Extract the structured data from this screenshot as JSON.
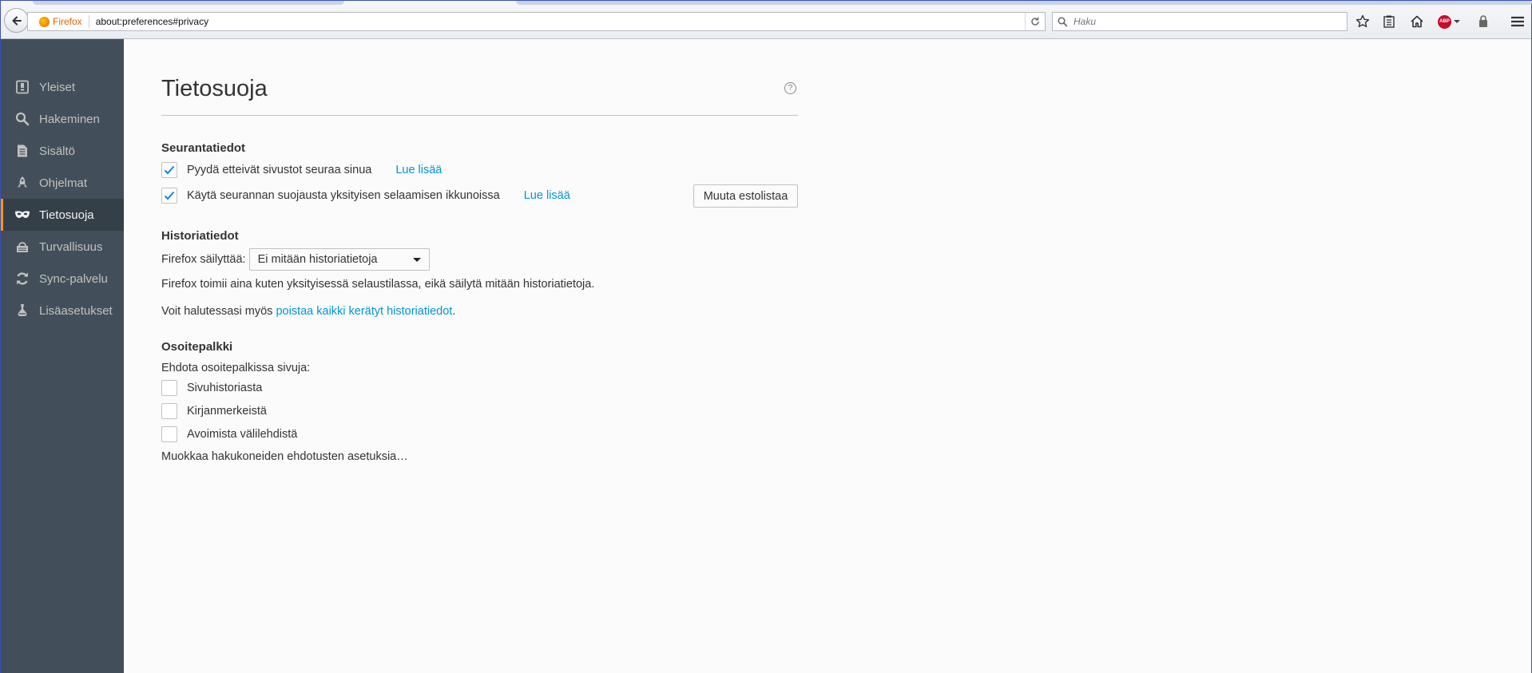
{
  "toolbar": {
    "identity_label": "Firefox",
    "url": "about:preferences#privacy",
    "search_placeholder": "Haku",
    "abp_label": "ABP"
  },
  "sidebar": {
    "items": [
      {
        "label": "Yleiset",
        "icon": "general-icon"
      },
      {
        "label": "Hakeminen",
        "icon": "search-icon"
      },
      {
        "label": "Sisältö",
        "icon": "content-icon"
      },
      {
        "label": "Ohjelmat",
        "icon": "applications-icon"
      },
      {
        "label": "Tietosuoja",
        "icon": "privacy-mask-icon",
        "selected": true
      },
      {
        "label": "Turvallisuus",
        "icon": "security-icon"
      },
      {
        "label": "Sync-palvelu",
        "icon": "sync-icon"
      },
      {
        "label": "Lisäasetukset",
        "icon": "advanced-icon"
      }
    ]
  },
  "main": {
    "title": "Tietosuoja",
    "help_label": "?",
    "tracking": {
      "heading": "Seurantatiedot",
      "dnt_label": "Pyydä etteivät sivustot seuraa sinua",
      "dnt_checked": true,
      "dnt_link": "Lue lisää",
      "tp_label": "Käytä seurannan suojausta yksityisen selaamisen ikkunoissa",
      "tp_checked": true,
      "tp_link": "Lue lisää",
      "blocklist_button": "Muuta estolistaa"
    },
    "history": {
      "heading": "Historiatiedot",
      "mode_label": "Firefox säilyttää:",
      "mode_value": "Ei mitään historiatietoja",
      "description": "Firefox toimii aina kuten yksityisessä selaustilassa, eikä säilytä mitään historiatietoja.",
      "clear_prefix": "Voit halutessasi myös ",
      "clear_link": "poistaa kaikki kerätyt historiatiedot",
      "clear_suffix": "."
    },
    "locationbar": {
      "heading": "Osoitepalkki",
      "suggest_label": "Ehdota osoitepalkissa sivuja:",
      "options": [
        {
          "label": "Sivuhistoriasta",
          "checked": false
        },
        {
          "label": "Kirjanmerkeistä",
          "checked": false
        },
        {
          "label": "Avoimista välilehdistä",
          "checked": false
        }
      ],
      "search_suggestions_link": "Muokkaa hakukoneiden ehdotusten asetuksia…"
    }
  },
  "colors": {
    "sidebar_bg": "#424f5a",
    "sidebar_selected_bg": "#343f48",
    "selected_accent": "#ff9500",
    "link": "#0095dd",
    "check": "#0a84ff"
  }
}
